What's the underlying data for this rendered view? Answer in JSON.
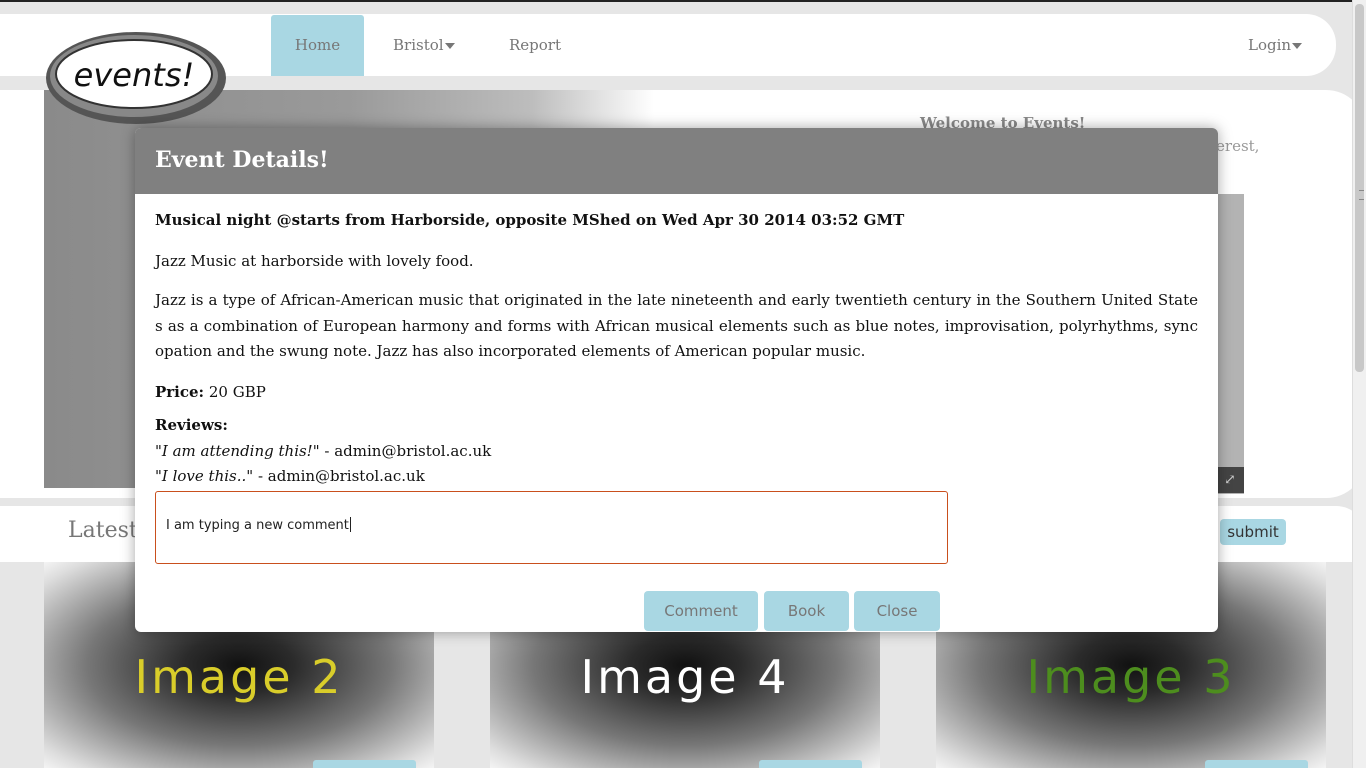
{
  "nav": {
    "home": "Home",
    "bristol": "Bristol",
    "report": "Report",
    "login": "Login"
  },
  "logo": {
    "text": "events!"
  },
  "hero": {
    "welcome_title": "Welcome to Events!",
    "welcome_text_fragment": "terest,"
  },
  "latest": {
    "title": "Latest",
    "submit": "submit"
  },
  "tiles": [
    {
      "label": "Image 2",
      "color": "#d9cd2a"
    },
    {
      "label": "Image 4",
      "color": "#ffffff"
    },
    {
      "label": "Image 3",
      "color": "#4d8d1e"
    }
  ],
  "modal": {
    "title": "Event Details!",
    "heading": "Musical night @starts from Harborside, opposite MShed on Wed Apr 30 2014 03:52 GMT",
    "summary": "Jazz Music at harborside with lovely food.",
    "description": "Jazz is a type of African-American music that originated in the late nineteenth and early twentieth century in the Southern United States as a combination of European harmony and forms with African musical elements such as blue notes, improvisation, polyrhythms, syncopation and the swung note. Jazz has also incorporated elements of American popular music.",
    "price_label": "Price:",
    "price_value": "20 GBP",
    "reviews_label": "Reviews:",
    "reviews": [
      {
        "text": "I am attending this!",
        "author": "admin@bristol.ac.uk"
      },
      {
        "text": "I love this..",
        "author": "admin@bristol.ac.uk"
      }
    ],
    "comment_value": "I am typing a new comment",
    "buttons": {
      "comment": "Comment",
      "book": "Book",
      "close": "Close"
    }
  },
  "colors": {
    "accent": "#a9d7e3",
    "modal_header": "#808080",
    "input_border": "#c94f1d"
  }
}
